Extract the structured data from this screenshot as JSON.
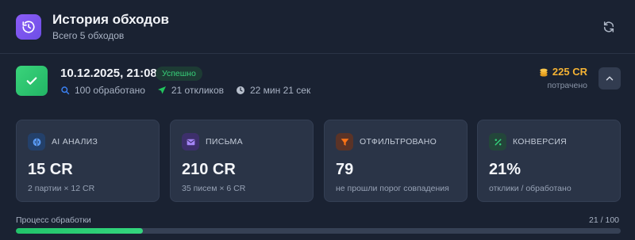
{
  "header": {
    "title": "История обходов",
    "subtitle": "Всего 5 обходов",
    "icon": "history-icon",
    "refresh_icon": "refresh-icon"
  },
  "run": {
    "date": "10.12.2025, 21:08",
    "status": "Успешно",
    "processed": "100 обработано",
    "responses": "21 откликов",
    "duration": "22 мин 21 сек",
    "cost": "225 CR",
    "cost_note": "потрачено",
    "status_icon": "check-icon",
    "collapse_icon": "chevron-up-icon"
  },
  "cards": [
    {
      "label": "AI анализ",
      "value": "15 CR",
      "note": "2 партии × 12 CR",
      "icon": "brain-icon",
      "accent": "#3b82f6"
    },
    {
      "label": "Письма",
      "value": "210 CR",
      "note": "35 писем × 6 CR",
      "icon": "mail-icon",
      "accent": "#8b5cf6"
    },
    {
      "label": "Отфильтровано",
      "value": "79",
      "note": "не прошли порог совпадения",
      "icon": "filter-icon",
      "accent": "#f97316"
    },
    {
      "label": "Конверсия",
      "value": "21%",
      "note": "отклики / обработано",
      "icon": "percent-icon",
      "accent": "#22c55e"
    }
  ],
  "progress": {
    "label": "Процесс обработки",
    "count": "21 / 100",
    "fraction": 0.21
  },
  "colors": {
    "background": "#1a2232",
    "card": "#2a3447",
    "success": "#22b565",
    "cost": "#f5b334"
  }
}
